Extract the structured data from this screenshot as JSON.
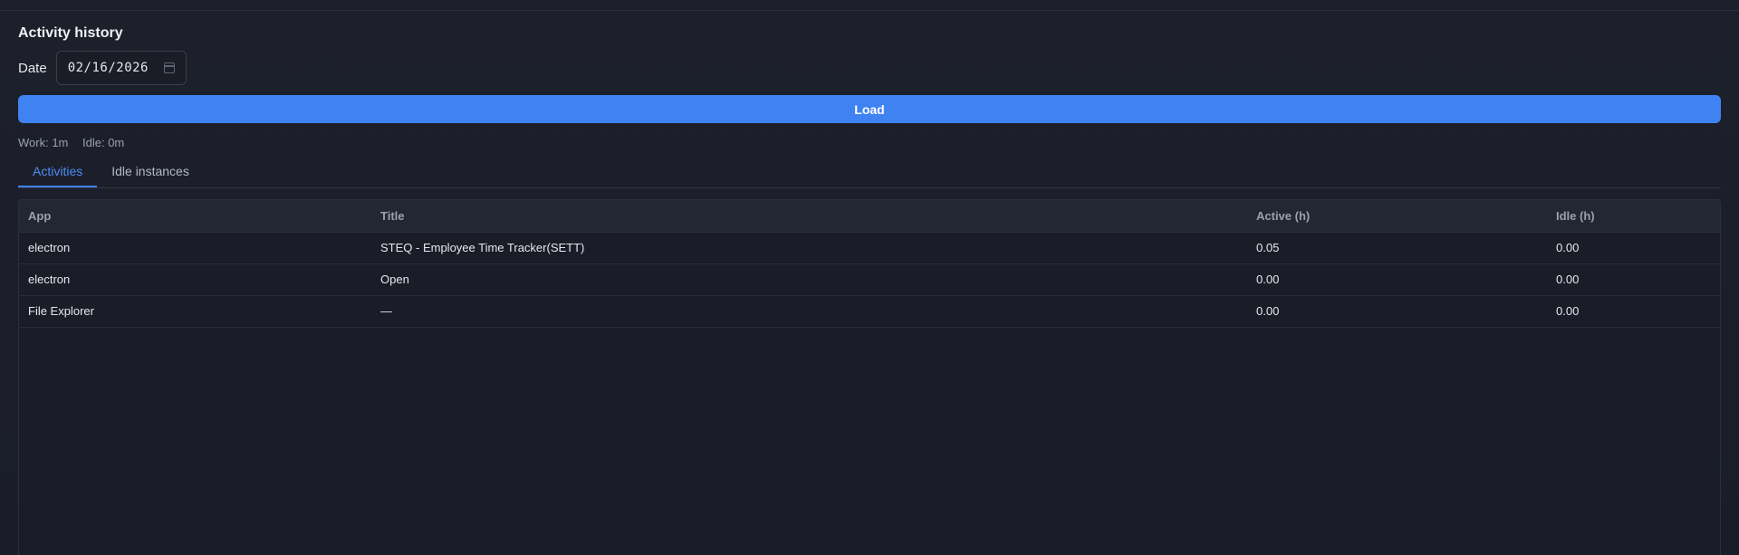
{
  "section": {
    "title": "Activity history"
  },
  "filter": {
    "date_label": "Date",
    "date_value": "02/16/2026",
    "load_label": "Load"
  },
  "summary": {
    "work": "Work: 1m",
    "idle": "Idle: 0m"
  },
  "tabs": [
    {
      "label": "Activities",
      "active": true
    },
    {
      "label": "Idle instances",
      "active": false
    }
  ],
  "table": {
    "columns": [
      "App",
      "Title",
      "Active (h)",
      "Idle (h)"
    ],
    "rows": [
      {
        "app": "electron",
        "title": "STEQ - Employee Time Tracker(SETT)",
        "active": "0.05",
        "idle": "0.00"
      },
      {
        "app": "electron",
        "title": "Open",
        "active": "0.00",
        "idle": "0.00"
      },
      {
        "app": "File Explorer",
        "title": "—",
        "active": "0.00",
        "idle": "0.00"
      }
    ]
  },
  "colors": {
    "accent": "#3f83f2",
    "background": "#1b1e29"
  }
}
